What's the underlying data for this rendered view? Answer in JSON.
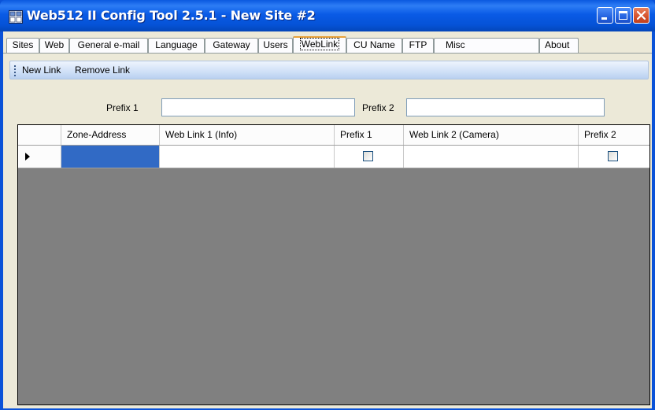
{
  "window": {
    "title": "Web512 II Config Tool 2.5.1 - New Site #2",
    "title_color": "#0a52d8",
    "icons": [
      "app-icon",
      "minimize-icon",
      "maximize-icon",
      "close-icon"
    ]
  },
  "tabs": [
    {
      "label": "Sites"
    },
    {
      "label": "Web"
    },
    {
      "label": "General e-mail"
    },
    {
      "label": "Language"
    },
    {
      "label": "Gateway"
    },
    {
      "label": "Users"
    },
    {
      "label": "WebLink",
      "active": true
    },
    {
      "label": "CU Name"
    },
    {
      "label": "FTP"
    },
    {
      "label": "Misc"
    },
    {
      "label": "About"
    }
  ],
  "toolbar": {
    "new_link": "New Link",
    "remove_link": "Remove Link"
  },
  "prefix_fields": {
    "prefix1_label": "Prefix 1",
    "prefix1_value": "",
    "prefix2_label": "Prefix 2",
    "prefix2_value": ""
  },
  "grid": {
    "columns": [
      "Zone-Address",
      "Web Link 1 (Info)",
      "Prefix 1",
      "Web Link 2 (Camera)",
      "Prefix 2"
    ],
    "rows": [
      {
        "zone_address": "",
        "web_link_1": "",
        "prefix1_checked": false,
        "web_link_2": "",
        "prefix2_checked": false
      }
    ],
    "selection_color": "#316ac5",
    "background_color": "#808080"
  }
}
